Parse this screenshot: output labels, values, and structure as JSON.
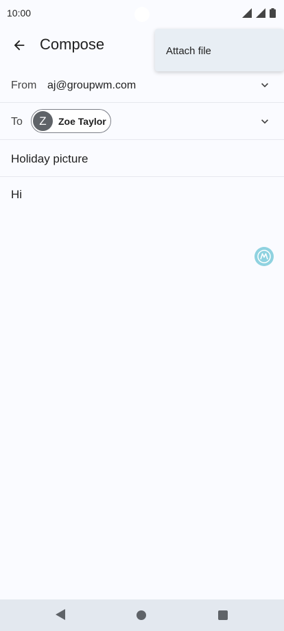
{
  "status_bar": {
    "time": "10:00"
  },
  "header": {
    "title": "Compose"
  },
  "from": {
    "label": "From",
    "value": "aj@groupwm.com"
  },
  "to": {
    "label": "To",
    "recipient_initial": "Z",
    "recipient_name": "Zoe Taylor"
  },
  "subject": {
    "value": "Holiday picture"
  },
  "body": {
    "value": "Hi"
  },
  "overflow_menu": {
    "items": [
      {
        "label": "Attach file"
      }
    ]
  },
  "icons": {
    "back": "arrow-left-icon",
    "from_expand": "chevron-down-icon",
    "to_expand": "chevron-down-icon",
    "assistant": "motorola-logo-icon"
  },
  "colors": {
    "background": "#fafbff",
    "menu_bg": "#e8eef4",
    "nav_bg": "#e3e8ef",
    "avatar": "#5f6368"
  }
}
